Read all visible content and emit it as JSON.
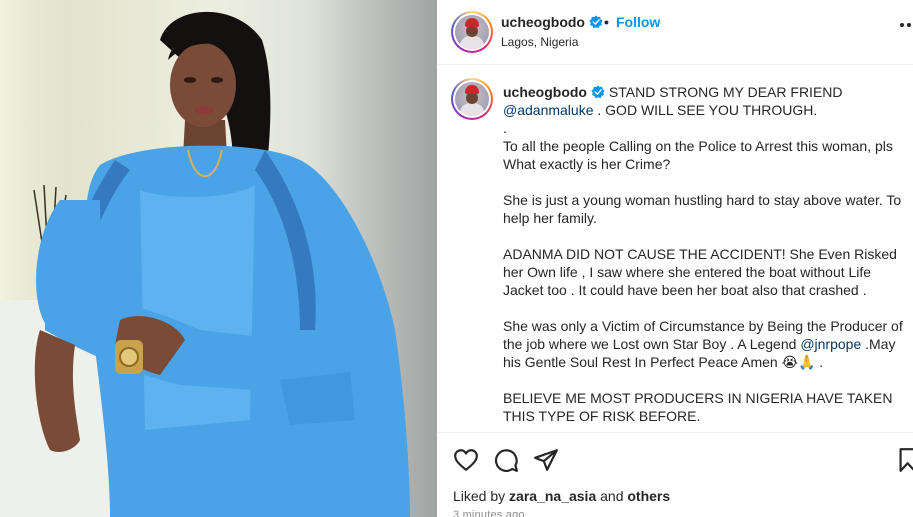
{
  "post": {
    "author": "ucheogbodo",
    "location": "Lagos, Nigeria",
    "follow_label": "Follow",
    "dot": "•",
    "caption_intro": "STAND STRONG MY DEAR FRIEND",
    "caption_mention1": "@adanmaluke",
    "caption_after_mention1": " . GOD WILL SEE YOU THROUGH.\n.\nTo all the people Calling on the Police to Arrest this woman, pls What exactly is her Crime?\n\nShe is just a young woman hustling hard to stay above water. To help her family.\n\nADANMA DID NOT CAUSE THE ACCIDENT! She Even Risked her Own life , I saw where she entered the boat without Life Jacket too . It could have been her boat also that crashed .\n\nShe was only a Victim of Circumstance by Being the Producer of the job where we Lost own Star Boy . A Legend ",
    "caption_mention2": "@jnrpope",
    "caption_after_mention2": " .May his Gentle Soul Rest In Perfect Peace Amen 😭🙏 .\n\nBELIEVE ME MOST PRODUCERS IN NIGERIA HAVE TAKEN THIS TYPE OF RISK BEFORE.",
    "likes_prefix": "Liked by ",
    "liked_by_user": "zara_na_asia",
    "likes_and": " and ",
    "likes_others": "others",
    "timestamp": "3 minutes ago"
  },
  "icons": {
    "verified": "verified-badge-icon",
    "more": "more-options-icon",
    "like": "heart-icon",
    "comment": "comment-icon",
    "share": "share-icon",
    "save": "bookmark-icon"
  },
  "colors": {
    "link": "#0095f6",
    "mention": "#00376b",
    "text": "#262626",
    "muted": "#8e8e8e",
    "suit": "#4aa3e6"
  }
}
